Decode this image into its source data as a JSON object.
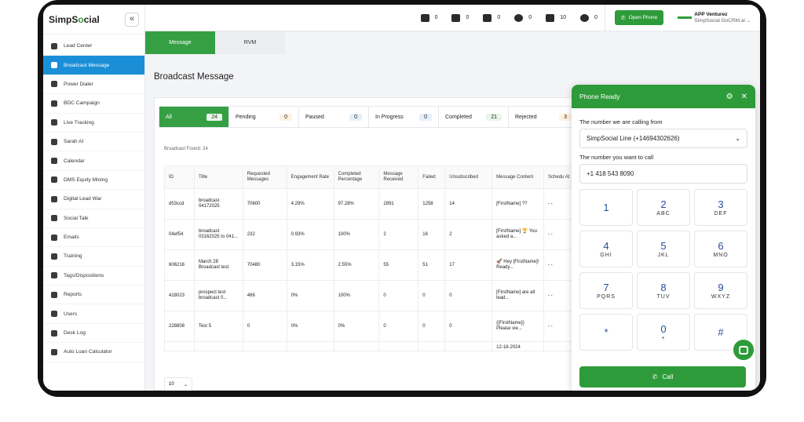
{
  "brand": {
    "logo_pre": "SimpS",
    "logo_o": "o",
    "logo_post": "cial",
    "collapse": "«"
  },
  "sidebar": {
    "items": [
      {
        "label": "Lead Center",
        "icon": "lead-center-icon"
      },
      {
        "label": "Broadcast Message",
        "icon": "broadcast-icon",
        "active": true
      },
      {
        "label": "Power Dialer",
        "icon": "headset-icon"
      },
      {
        "label": "BDC Campaign",
        "icon": "megaphone-icon"
      },
      {
        "label": "Live Tracking",
        "icon": "tracking-icon"
      },
      {
        "label": "Sarah AI",
        "icon": "robot-icon"
      },
      {
        "label": "Calendar",
        "icon": "calendar-icon"
      },
      {
        "label": "DMS Equity Mining",
        "icon": "dms-icon"
      },
      {
        "label": "Digital Lead War",
        "icon": "rocket-icon"
      },
      {
        "label": "Social Talk",
        "icon": "chat-icon"
      },
      {
        "label": "Emails",
        "icon": "mail-icon"
      },
      {
        "label": "Training",
        "icon": "training-icon"
      },
      {
        "label": "Tags/Dispositions",
        "icon": "tag-icon"
      },
      {
        "label": "Reports",
        "icon": "reports-icon"
      },
      {
        "label": "Users",
        "icon": "users-icon"
      },
      {
        "label": "Desk Log",
        "icon": "desk-log-icon"
      },
      {
        "label": "Auto Loan Calculator",
        "icon": "calculator-icon"
      }
    ]
  },
  "topbar": {
    "counters": [
      {
        "icon": "mail-icon",
        "value": "0"
      },
      {
        "icon": "message-icon",
        "value": "0"
      },
      {
        "icon": "missed-call-icon",
        "value": "0"
      },
      {
        "icon": "alarm-icon",
        "value": "0"
      },
      {
        "icon": "bell-icon",
        "value": "10"
      },
      {
        "icon": "at-icon",
        "value": "0"
      }
    ],
    "open_phone": "Open Phone",
    "user_name": "APP Venturez",
    "user_company": "SimpSocial GoCRM.ai"
  },
  "tabs": [
    "Message",
    "RVM"
  ],
  "page_title": "Broadcast Message",
  "filters": [
    {
      "label": "All",
      "count": "24",
      "bg": "#e8f5e9"
    },
    {
      "label": "Pending",
      "count": "0",
      "bg": "#fff1e0"
    },
    {
      "label": "Paused",
      "count": "0",
      "bg": "#e3f0fb"
    },
    {
      "label": "In Progress",
      "count": "0",
      "bg": "#e3f0fb"
    },
    {
      "label": "Completed",
      "count": "21",
      "bg": "#e8f5e9"
    },
    {
      "label": "Rejected",
      "count": "3",
      "bg": "#fff1e0"
    }
  ],
  "found_text": "Broadcast Found: 24",
  "table": {
    "headers": [
      "ID",
      "Title",
      "Requested Messages",
      "Engagement Rate",
      "Completed Percentage",
      "Message Received",
      "Failed",
      "Unsubscribed",
      "Message Content",
      "Schedu At"
    ],
    "rows": [
      [
        "d53ccd",
        "broadcast 04172025",
        "70600",
        "4.29%",
        "97.28%",
        "2891",
        "1258",
        "14",
        "[FirstName] ??",
        "- -"
      ],
      [
        "04ef54",
        "broadcast 03162025 to 041...",
        "232",
        "0.93%",
        "100%",
        "2",
        "16",
        "2",
        "[FirstName] 🏆 You asked a...",
        "- -"
      ],
      [
        "606216",
        "March 28 Broadcast test",
        "70480",
        "3.15%",
        "2.55%",
        "55",
        "51",
        "17",
        "🚀 Hey [FirstName]! Ready...",
        "- -"
      ],
      [
        "418023",
        "prospect test broadcast 0...",
        "466",
        "0%",
        "100%",
        "0",
        "0",
        "0",
        "[FirstName] are all lead...",
        "- -"
      ],
      [
        "228808",
        "Test 5",
        "0",
        "0%",
        "0%",
        "0",
        "0",
        "0",
        "{{FirstName}} Please vie...",
        "- -"
      ],
      [
        "",
        "",
        "",
        "",
        "",
        "",
        "",
        "",
        "12-18-2024",
        ""
      ]
    ]
  },
  "pager": {
    "value": "10"
  },
  "phone": {
    "title": "Phone Ready",
    "calling_from_label": "The number we are calling from",
    "calling_from_value": "SimpSocial Line (+14694302626)",
    "call_to_label": "The number you want to call",
    "call_to_value": "+1 418 543 8090",
    "keys": [
      {
        "d": "1",
        "l": ""
      },
      {
        "d": "2",
        "l": "ABC"
      },
      {
        "d": "3",
        "l": "DEF"
      },
      {
        "d": "4",
        "l": "GHI"
      },
      {
        "d": "5",
        "l": "JKL"
      },
      {
        "d": "6",
        "l": "MNO"
      },
      {
        "d": "7",
        "l": "PQRS"
      },
      {
        "d": "8",
        "l": "TUV"
      },
      {
        "d": "9",
        "l": "WXYZ"
      },
      {
        "d": "*",
        "l": ""
      },
      {
        "d": "0",
        "l": "+"
      },
      {
        "d": "#",
        "l": ""
      }
    ],
    "call_label": "Call"
  },
  "colors": {
    "accent_green": "#2e9b3a",
    "active_blue": "#1a8fd8",
    "digit_blue": "#2a4d9b"
  }
}
